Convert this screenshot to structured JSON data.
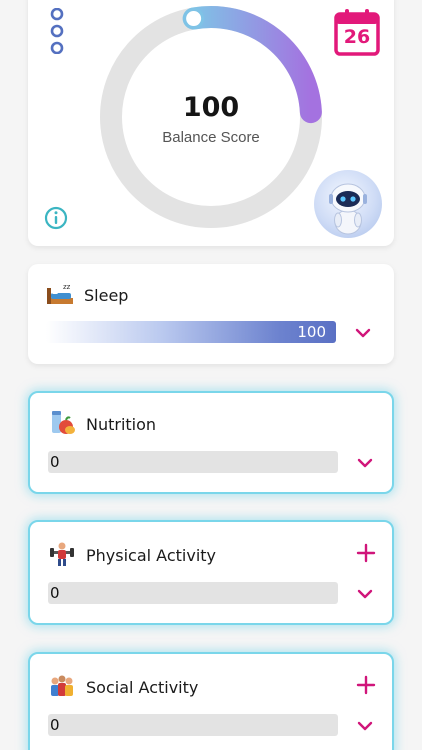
{
  "score": {
    "value": "100",
    "label": "Balance Score",
    "progress": 0.27
  },
  "calendar": {
    "day": "26"
  },
  "categories": [
    {
      "title": "Sleep",
      "value": "100",
      "progress": 1.0
    },
    {
      "title": "Nutrition",
      "value": "0",
      "progress": 0.0
    },
    {
      "title": "Physical Activity",
      "value": "0",
      "progress": 0.0
    },
    {
      "title": "Social Activity",
      "value": "0",
      "progress": 0.0
    }
  ],
  "colors": {
    "accent": "#e2197a",
    "ring_start": "#7fc3e6",
    "ring_end": "#a472e0",
    "glow": "#7ad6ea",
    "bar_fill": "#5a70c4"
  },
  "icons": [
    "more-dots-icon",
    "calendar-icon",
    "info-icon",
    "robot-avatar",
    "sleep-icon",
    "nutrition-icon",
    "physical-activity-icon",
    "social-activity-icon",
    "chevron-down-icon",
    "plus-icon"
  ]
}
